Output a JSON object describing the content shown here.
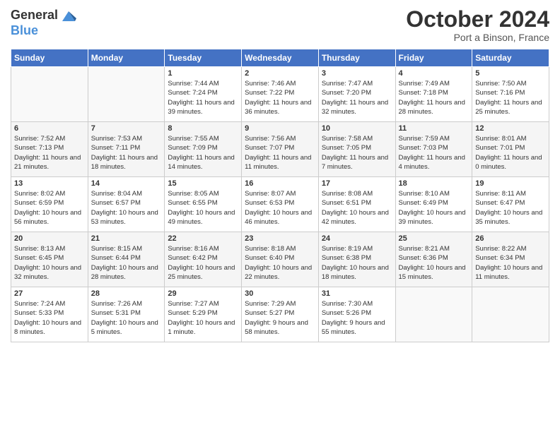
{
  "logo": {
    "general": "General",
    "blue": "Blue"
  },
  "header": {
    "month": "October 2024",
    "location": "Port a Binson, France"
  },
  "weekdays": [
    "Sunday",
    "Monday",
    "Tuesday",
    "Wednesday",
    "Thursday",
    "Friday",
    "Saturday"
  ],
  "weeks": [
    [
      {
        "day": "",
        "sunrise": "",
        "sunset": "",
        "daylight": ""
      },
      {
        "day": "",
        "sunrise": "",
        "sunset": "",
        "daylight": ""
      },
      {
        "day": "1",
        "sunrise": "Sunrise: 7:44 AM",
        "sunset": "Sunset: 7:24 PM",
        "daylight": "Daylight: 11 hours and 39 minutes."
      },
      {
        "day": "2",
        "sunrise": "Sunrise: 7:46 AM",
        "sunset": "Sunset: 7:22 PM",
        "daylight": "Daylight: 11 hours and 36 minutes."
      },
      {
        "day": "3",
        "sunrise": "Sunrise: 7:47 AM",
        "sunset": "Sunset: 7:20 PM",
        "daylight": "Daylight: 11 hours and 32 minutes."
      },
      {
        "day": "4",
        "sunrise": "Sunrise: 7:49 AM",
        "sunset": "Sunset: 7:18 PM",
        "daylight": "Daylight: 11 hours and 28 minutes."
      },
      {
        "day": "5",
        "sunrise": "Sunrise: 7:50 AM",
        "sunset": "Sunset: 7:16 PM",
        "daylight": "Daylight: 11 hours and 25 minutes."
      }
    ],
    [
      {
        "day": "6",
        "sunrise": "Sunrise: 7:52 AM",
        "sunset": "Sunset: 7:13 PM",
        "daylight": "Daylight: 11 hours and 21 minutes."
      },
      {
        "day": "7",
        "sunrise": "Sunrise: 7:53 AM",
        "sunset": "Sunset: 7:11 PM",
        "daylight": "Daylight: 11 hours and 18 minutes."
      },
      {
        "day": "8",
        "sunrise": "Sunrise: 7:55 AM",
        "sunset": "Sunset: 7:09 PM",
        "daylight": "Daylight: 11 hours and 14 minutes."
      },
      {
        "day": "9",
        "sunrise": "Sunrise: 7:56 AM",
        "sunset": "Sunset: 7:07 PM",
        "daylight": "Daylight: 11 hours and 11 minutes."
      },
      {
        "day": "10",
        "sunrise": "Sunrise: 7:58 AM",
        "sunset": "Sunset: 7:05 PM",
        "daylight": "Daylight: 11 hours and 7 minutes."
      },
      {
        "day": "11",
        "sunrise": "Sunrise: 7:59 AM",
        "sunset": "Sunset: 7:03 PM",
        "daylight": "Daylight: 11 hours and 4 minutes."
      },
      {
        "day": "12",
        "sunrise": "Sunrise: 8:01 AM",
        "sunset": "Sunset: 7:01 PM",
        "daylight": "Daylight: 11 hours and 0 minutes."
      }
    ],
    [
      {
        "day": "13",
        "sunrise": "Sunrise: 8:02 AM",
        "sunset": "Sunset: 6:59 PM",
        "daylight": "Daylight: 10 hours and 56 minutes."
      },
      {
        "day": "14",
        "sunrise": "Sunrise: 8:04 AM",
        "sunset": "Sunset: 6:57 PM",
        "daylight": "Daylight: 10 hours and 53 minutes."
      },
      {
        "day": "15",
        "sunrise": "Sunrise: 8:05 AM",
        "sunset": "Sunset: 6:55 PM",
        "daylight": "Daylight: 10 hours and 49 minutes."
      },
      {
        "day": "16",
        "sunrise": "Sunrise: 8:07 AM",
        "sunset": "Sunset: 6:53 PM",
        "daylight": "Daylight: 10 hours and 46 minutes."
      },
      {
        "day": "17",
        "sunrise": "Sunrise: 8:08 AM",
        "sunset": "Sunset: 6:51 PM",
        "daylight": "Daylight: 10 hours and 42 minutes."
      },
      {
        "day": "18",
        "sunrise": "Sunrise: 8:10 AM",
        "sunset": "Sunset: 6:49 PM",
        "daylight": "Daylight: 10 hours and 39 minutes."
      },
      {
        "day": "19",
        "sunrise": "Sunrise: 8:11 AM",
        "sunset": "Sunset: 6:47 PM",
        "daylight": "Daylight: 10 hours and 35 minutes."
      }
    ],
    [
      {
        "day": "20",
        "sunrise": "Sunrise: 8:13 AM",
        "sunset": "Sunset: 6:45 PM",
        "daylight": "Daylight: 10 hours and 32 minutes."
      },
      {
        "day": "21",
        "sunrise": "Sunrise: 8:15 AM",
        "sunset": "Sunset: 6:44 PM",
        "daylight": "Daylight: 10 hours and 28 minutes."
      },
      {
        "day": "22",
        "sunrise": "Sunrise: 8:16 AM",
        "sunset": "Sunset: 6:42 PM",
        "daylight": "Daylight: 10 hours and 25 minutes."
      },
      {
        "day": "23",
        "sunrise": "Sunrise: 8:18 AM",
        "sunset": "Sunset: 6:40 PM",
        "daylight": "Daylight: 10 hours and 22 minutes."
      },
      {
        "day": "24",
        "sunrise": "Sunrise: 8:19 AM",
        "sunset": "Sunset: 6:38 PM",
        "daylight": "Daylight: 10 hours and 18 minutes."
      },
      {
        "day": "25",
        "sunrise": "Sunrise: 8:21 AM",
        "sunset": "Sunset: 6:36 PM",
        "daylight": "Daylight: 10 hours and 15 minutes."
      },
      {
        "day": "26",
        "sunrise": "Sunrise: 8:22 AM",
        "sunset": "Sunset: 6:34 PM",
        "daylight": "Daylight: 10 hours and 11 minutes."
      }
    ],
    [
      {
        "day": "27",
        "sunrise": "Sunrise: 7:24 AM",
        "sunset": "Sunset: 5:33 PM",
        "daylight": "Daylight: 10 hours and 8 minutes."
      },
      {
        "day": "28",
        "sunrise": "Sunrise: 7:26 AM",
        "sunset": "Sunset: 5:31 PM",
        "daylight": "Daylight: 10 hours and 5 minutes."
      },
      {
        "day": "29",
        "sunrise": "Sunrise: 7:27 AM",
        "sunset": "Sunset: 5:29 PM",
        "daylight": "Daylight: 10 hours and 1 minute."
      },
      {
        "day": "30",
        "sunrise": "Sunrise: 7:29 AM",
        "sunset": "Sunset: 5:27 PM",
        "daylight": "Daylight: 9 hours and 58 minutes."
      },
      {
        "day": "31",
        "sunrise": "Sunrise: 7:30 AM",
        "sunset": "Sunset: 5:26 PM",
        "daylight": "Daylight: 9 hours and 55 minutes."
      },
      {
        "day": "",
        "sunrise": "",
        "sunset": "",
        "daylight": ""
      },
      {
        "day": "",
        "sunrise": "",
        "sunset": "",
        "daylight": ""
      }
    ]
  ]
}
